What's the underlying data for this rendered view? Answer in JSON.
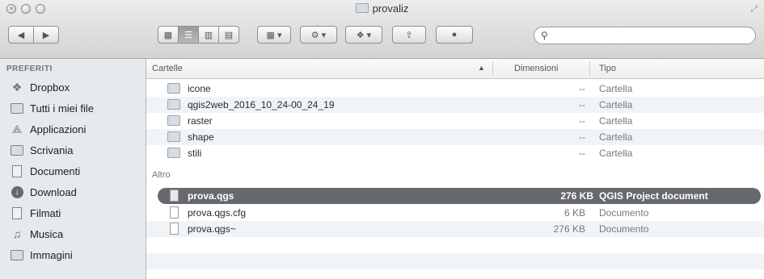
{
  "window": {
    "title": "provaliz"
  },
  "toolbar": {
    "search_placeholder": ""
  },
  "sidebar": {
    "heading": "PREFERITI",
    "items": [
      {
        "label": "Dropbox",
        "icon": "dropbox-icon"
      },
      {
        "label": "Tutti i miei file",
        "icon": "all-files-icon"
      },
      {
        "label": "Applicazioni",
        "icon": "applications-icon"
      },
      {
        "label": "Scrivania",
        "icon": "desktop-icon"
      },
      {
        "label": "Documenti",
        "icon": "documents-icon"
      },
      {
        "label": "Download",
        "icon": "download-icon"
      },
      {
        "label": "Filmati",
        "icon": "movies-icon"
      },
      {
        "label": "Musica",
        "icon": "music-icon"
      },
      {
        "label": "Immagini",
        "icon": "pictures-icon"
      }
    ]
  },
  "list": {
    "columns": {
      "name": "Cartelle",
      "size": "Dimensioni",
      "kind": "Tipo"
    },
    "folders": [
      {
        "name": "icone",
        "size": "--",
        "kind": "Cartella"
      },
      {
        "name": "qgis2web_2016_10_24-00_24_19",
        "size": "--",
        "kind": "Cartella"
      },
      {
        "name": "raster",
        "size": "--",
        "kind": "Cartella"
      },
      {
        "name": "shape",
        "size": "--",
        "kind": "Cartella"
      },
      {
        "name": "stili",
        "size": "--",
        "kind": "Cartella"
      }
    ],
    "other_heading": "Altro",
    "files": [
      {
        "name": "prova.qgs",
        "size": "276 KB",
        "kind": "QGIS Project document",
        "selected": true
      },
      {
        "name": "prova.qgs.cfg",
        "size": "6 KB",
        "kind": "Documento"
      },
      {
        "name": "prova.qgs~",
        "size": "276 KB",
        "kind": "Documento"
      }
    ]
  }
}
